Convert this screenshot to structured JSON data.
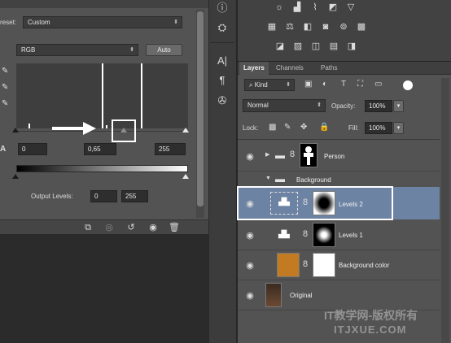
{
  "properties": {
    "preset_label": "reset:",
    "preset_value": "Custom",
    "channel_value": "RGB",
    "auto_label": "Auto",
    "input_black": "0",
    "input_gamma": "0,65",
    "input_white": "255",
    "output_label": "Output Levels:",
    "output_black": "0",
    "output_white": "255",
    "levels_icon_text": "A"
  },
  "tools": [
    "info-icon",
    "swatch-icon",
    "type-icon",
    "paragraph-icon",
    "brush-preset-icon"
  ],
  "adjustments": {
    "row1": [
      "brightness-icon",
      "levels-icon",
      "curves-icon",
      "exposure-icon",
      "vibrance-icon"
    ],
    "row2": [
      "hue-icon",
      "color-balance-icon",
      "black-white-icon",
      "photo-filter-icon",
      "channel-mixer-icon",
      "lookup-icon"
    ],
    "row3": [
      "invert-icon",
      "posterize-icon",
      "threshold-icon",
      "gradient-map-icon",
      "selective-color-icon"
    ]
  },
  "layers_panel": {
    "tabs": [
      "Layers",
      "Channels",
      "Paths"
    ],
    "filter_kind": "Kind",
    "blend_mode": "Normal",
    "opacity_label": "Opacity:",
    "opacity_value": "100%",
    "lock_label": "Lock:",
    "fill_label": "Fill:",
    "fill_value": "100%",
    "layers": [
      {
        "name": "Person"
      },
      {
        "name": "Background"
      },
      {
        "name": "Levels 2"
      },
      {
        "name": "Levels 1"
      },
      {
        "name": "Background color"
      },
      {
        "name": "Original"
      }
    ]
  },
  "watermark": {
    "line1": "IT教学网-版权所有",
    "line2": "ITJXUE.COM"
  },
  "colors": {
    "background_color_swatch": "#c27a23",
    "selected_layer": "#6d83a3"
  }
}
